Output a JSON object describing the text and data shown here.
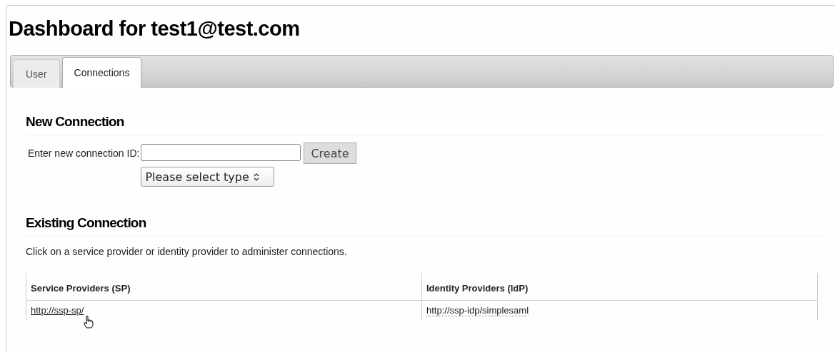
{
  "title": "Dashboard for test1@test.com",
  "tabs": [
    {
      "label": "User",
      "selected": false
    },
    {
      "label": "Connections",
      "selected": true
    }
  ],
  "new_connection": {
    "heading": "New Connection",
    "label": "Enter new connection ID:",
    "button": "Create",
    "select": "Please select type"
  },
  "existing_connection": {
    "heading": "Existing Connection",
    "description": "Click on a service provider or identity provider to administer connections.",
    "table": {
      "columns": [
        "Service Providers (SP)",
        "Identity Providers (IdP)"
      ],
      "rows": [
        [
          "http://ssp-sp/",
          "http://ssp-idp/simplesaml"
        ]
      ]
    }
  }
}
